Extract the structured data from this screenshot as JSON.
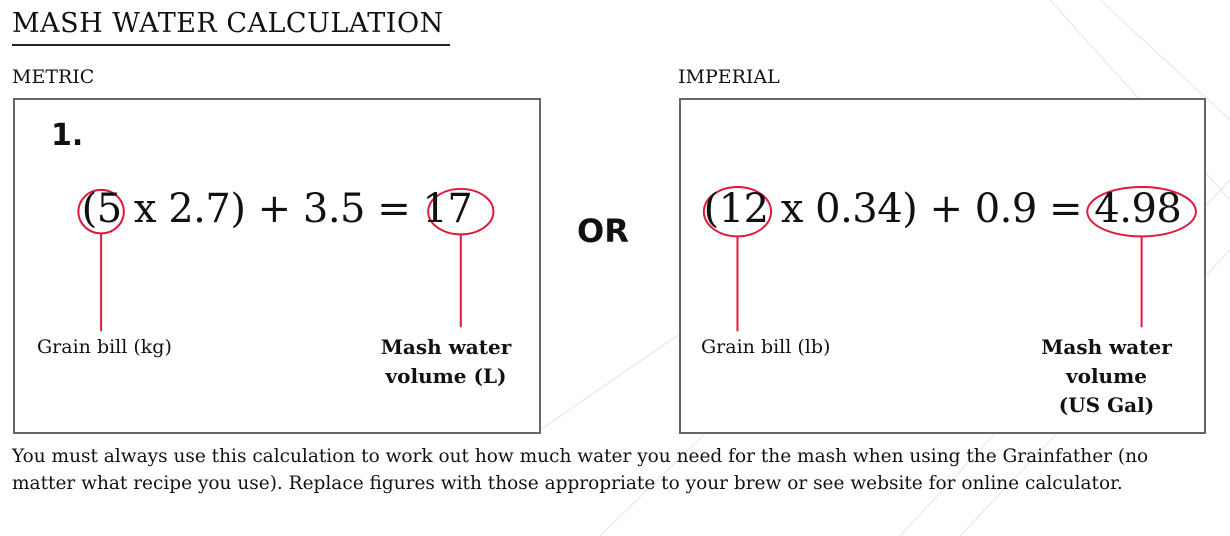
{
  "page": {
    "title": "MASH WATER CALCULATION",
    "or_label": "OR",
    "note": "You must always use this calculation to work out how much water you need for the mash when using the Grainfather (no matter what recipe you use). Replace figures with those appropriate to your brew or see website for online calculator."
  },
  "metric": {
    "label": "METRIC",
    "step": "1.",
    "formula": "(5 x 2.7) + 3.5 = 17",
    "grain_label": "Grain bill (kg)",
    "result_label_line1": "Mash water",
    "result_label_line2": "volume (L)"
  },
  "imperial": {
    "label": "IMPERIAL",
    "formula": "(12 x 0.34) + 0.9 = 4.98",
    "grain_label": "Grain bill (lb)",
    "result_label_line1": "Mash water",
    "result_label_line2": "volume",
    "result_label_line3": "(US Gal)"
  },
  "colors": {
    "accent": "#e0193a",
    "border": "#666666",
    "text": "#111111"
  }
}
